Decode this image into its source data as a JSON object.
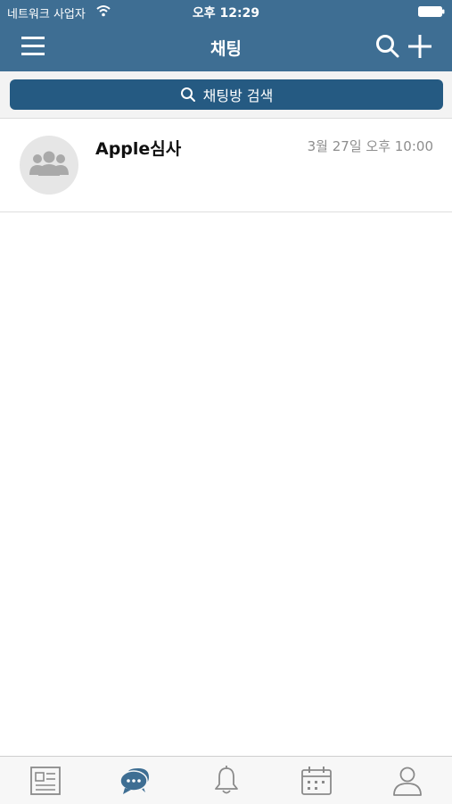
{
  "status_bar": {
    "carrier": "네트워크 사업자",
    "time": "오후 12:29"
  },
  "nav": {
    "title": "채팅"
  },
  "search": {
    "label": "채팅방 검색"
  },
  "rooms": [
    {
      "name": "Apple심사",
      "date": "3월 27일 오후 10:00"
    }
  ],
  "tabs": [
    {
      "icon": "news-icon",
      "active": false
    },
    {
      "icon": "chat-icon",
      "active": true
    },
    {
      "icon": "bell-icon",
      "active": false
    },
    {
      "icon": "calendar-icon",
      "active": false
    },
    {
      "icon": "person-icon",
      "active": false
    }
  ],
  "colors": {
    "header": "#3e6e93",
    "search_button": "#255a82",
    "active_tab": "#3e6e93",
    "inactive_tab": "#8a8a8a"
  }
}
